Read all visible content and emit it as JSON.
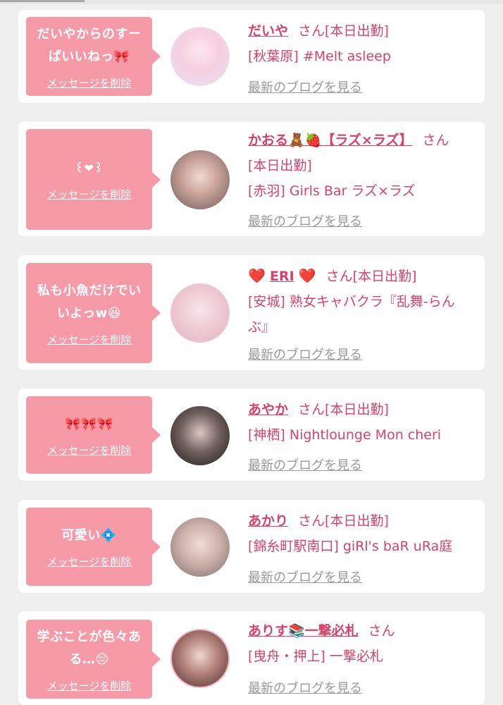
{
  "cards": [
    {
      "message": "だいやからのすーぱいいねっ🎀",
      "delete_label": "メッセージを削除",
      "name": "だいや",
      "san": "さん",
      "status": "[本日出勤]",
      "shop": "[秋葉原] #Melt asleep",
      "blog_link": "最新のブログを見る"
    },
    {
      "message": "꒰❤︎꒱",
      "delete_label": "メッセージを削除",
      "name": "かおる🧸🍓【ラズ×ラズ】",
      "san": "さん",
      "status": "[本日出勤]",
      "shop": "[赤羽] Girls Bar ラズ×ラズ",
      "blog_link": "最新のブログを見る"
    },
    {
      "message": "私も小魚だけでいいよっw😆",
      "delete_label": "メッセージを削除",
      "name": "ERI",
      "heart_left": "❤️",
      "heart_right": "❤️",
      "san": "さん",
      "status": "[本日出勤]",
      "shop": "[安城] 熟女キャバクラ『乱舞-らんぶ』",
      "blog_link": "最新のブログを見る"
    },
    {
      "message": "🎀🎀🎀",
      "delete_label": "メッセージを削除",
      "name": "あやか",
      "san": "さん",
      "status": "[本日出勤]",
      "shop": "[神栖] Nightlounge Mon cheri",
      "blog_link": "最新のブログを見る"
    },
    {
      "message": "可愛い💠",
      "delete_label": "メッセージを削除",
      "name": "あかり",
      "san": "さん",
      "status": "[本日出勤]",
      "shop": "[錦糸町駅南口] giRl's baR uRa庭",
      "blog_link": "最新のブログを見る"
    },
    {
      "message": "学ぶことが色々ある…😔",
      "delete_label": "メッセージを削除",
      "name": "ありす📚一撃必札",
      "san": "さん",
      "status": "",
      "shop": "[曳舟・押上] 一撃必札",
      "blog_link": "最新のブログを見る"
    }
  ],
  "colors": {
    "bubble": "#f79aa7",
    "accent": "#d6426c",
    "muted": "#999999",
    "background": "#efefef"
  }
}
